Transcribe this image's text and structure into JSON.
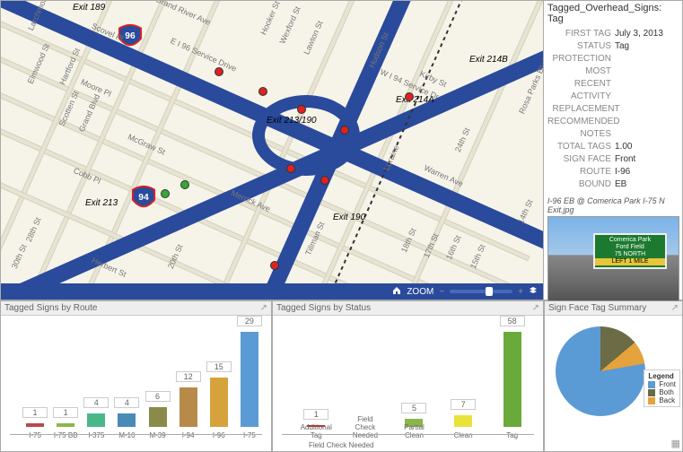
{
  "details": {
    "title": "Tagged_Overhead_Signs: Tag",
    "fields": {
      "first_tag_k": "FIRST TAG",
      "first_tag_v": "July 3, 2013",
      "status_k": "STATUS",
      "status_v": "Tag",
      "protection_k": "PROTECTION",
      "protection_v": "",
      "recent_k": "MOST RECENT ACTIVITY",
      "recent_v": "",
      "replace_k": "REPLACEMENT RECOMMENDED",
      "replace_v": "",
      "notes_k": "NOTES",
      "notes_v": "",
      "total_k": "TOTAL TAGS",
      "total_v": "1.00",
      "face_k": "SIGN FACE",
      "face_v": "Front",
      "route_k": "ROUTE",
      "route_v": "I-96",
      "bound_k": "BOUND",
      "bound_v": "EB"
    },
    "photo_caption": "I-96 EB @ Comerica Park I-75 N Exit.jpg",
    "sign_line1": "Comerica Park",
    "sign_line2": "Ford Field",
    "sign_line3": "75 NORTH",
    "sign_bottom": "LEFT 1 MILE"
  },
  "map": {
    "zoom_label": "ZOOM",
    "exits": {
      "e189": "Exit 189",
      "e214b": "Exit 214B",
      "e214a": "Exit 214A",
      "e213190": "Exit 213/190",
      "e213": "Exit 213",
      "e190": "Exit 190"
    },
    "streets": {
      "grand_river": "Grand River Ave",
      "scovel": "Scovel Pl",
      "hartford": "Hartford St",
      "moore": "Moore Pl",
      "scotten": "Scotten St",
      "grand_blvd": "Grand Blvd",
      "mcgraw": "McGraw St",
      "cobb": "Cobb Pl",
      "herbert": "Herbert St",
      "merrick": "Merrick Ave",
      "warren": "Warren Ave",
      "kirby": "Kirby St",
      "hudson": "Hudson St",
      "hooker": "Hooker St",
      "wexford": "Wexford St",
      "lawton": "Lawton St",
      "tillman": "Tillman St",
      "loraine": "Loraine",
      "rosa": "Rosa Parks Blvd",
      "service": "E I 96 Service Drive",
      "i94": "W I 94 Service Dr",
      "s30": "30th St",
      "s28": "28th St",
      "s20": "20th St",
      "s24": "24th St",
      "s14": "14th St",
      "s15": "15th St",
      "s16": "16th St",
      "s17": "17th St",
      "s18": "18th St",
      "larchmont": "Larchmont",
      "elmwood": "Elmwood St"
    },
    "shields": {
      "i96": "96",
      "i94": "94"
    }
  },
  "chart1": {
    "title": "Tagged Signs by Route",
    "categories": [
      "I-75",
      "I-75 BB",
      "I-375",
      "M-10",
      "M-39",
      "I-94",
      "I-96",
      "I-75"
    ],
    "values": [
      1,
      1,
      4,
      4,
      6,
      12,
      15,
      29
    ],
    "colors": [
      "#b74a4a",
      "#8ab74a",
      "#4ab78a",
      "#4a8ab7",
      "#8a8a4a",
      "#b78a4a",
      "#d6a23c",
      "#5b9bd5"
    ]
  },
  "chart2": {
    "title": "Tagged Signs by Status",
    "categories": [
      "Additional Tag",
      "Field Check Needed",
      "Partial Clean",
      "Clean",
      "Tag"
    ],
    "values": [
      1,
      0,
      5,
      7,
      58
    ],
    "colors": [
      "#d22",
      "#d6a23c",
      "#8ab74a",
      "#e8e23a",
      "#6aaa3a"
    ],
    "group_label": "Field Check Needed"
  },
  "chart3": {
    "title": "Sign Face Tag Summary",
    "legend_title": "Legend",
    "legend": [
      {
        "label": "Front",
        "color": "#5b9bd5"
      },
      {
        "label": "Both",
        "color": "#6b6b45"
      },
      {
        "label": "Back",
        "color": "#e6a23c"
      }
    ]
  },
  "chart_data": [
    {
      "type": "bar",
      "title": "Tagged Signs by Route",
      "categories": [
        "I-75",
        "I-75 BB",
        "I-375",
        "M-10",
        "M-39",
        "I-94",
        "I-96",
        "I-75"
      ],
      "values": [
        1,
        1,
        4,
        4,
        6,
        12,
        15,
        29
      ],
      "xlabel": "",
      "ylabel": "",
      "ylim": [
        0,
        30
      ]
    },
    {
      "type": "bar",
      "title": "Tagged Signs by Status",
      "categories": [
        "Additional Tag",
        "Field Check Needed",
        "Partial Clean",
        "Clean",
        "Tag"
      ],
      "values": [
        1,
        0,
        5,
        7,
        58
      ],
      "xlabel": "",
      "ylabel": "",
      "ylim": [
        0,
        60
      ]
    },
    {
      "type": "pie",
      "title": "Sign Face Tag Summary",
      "series": [
        {
          "name": "Front",
          "value": 78
        },
        {
          "name": "Both",
          "value": 14
        },
        {
          "name": "Back",
          "value": 8
        }
      ]
    }
  ]
}
